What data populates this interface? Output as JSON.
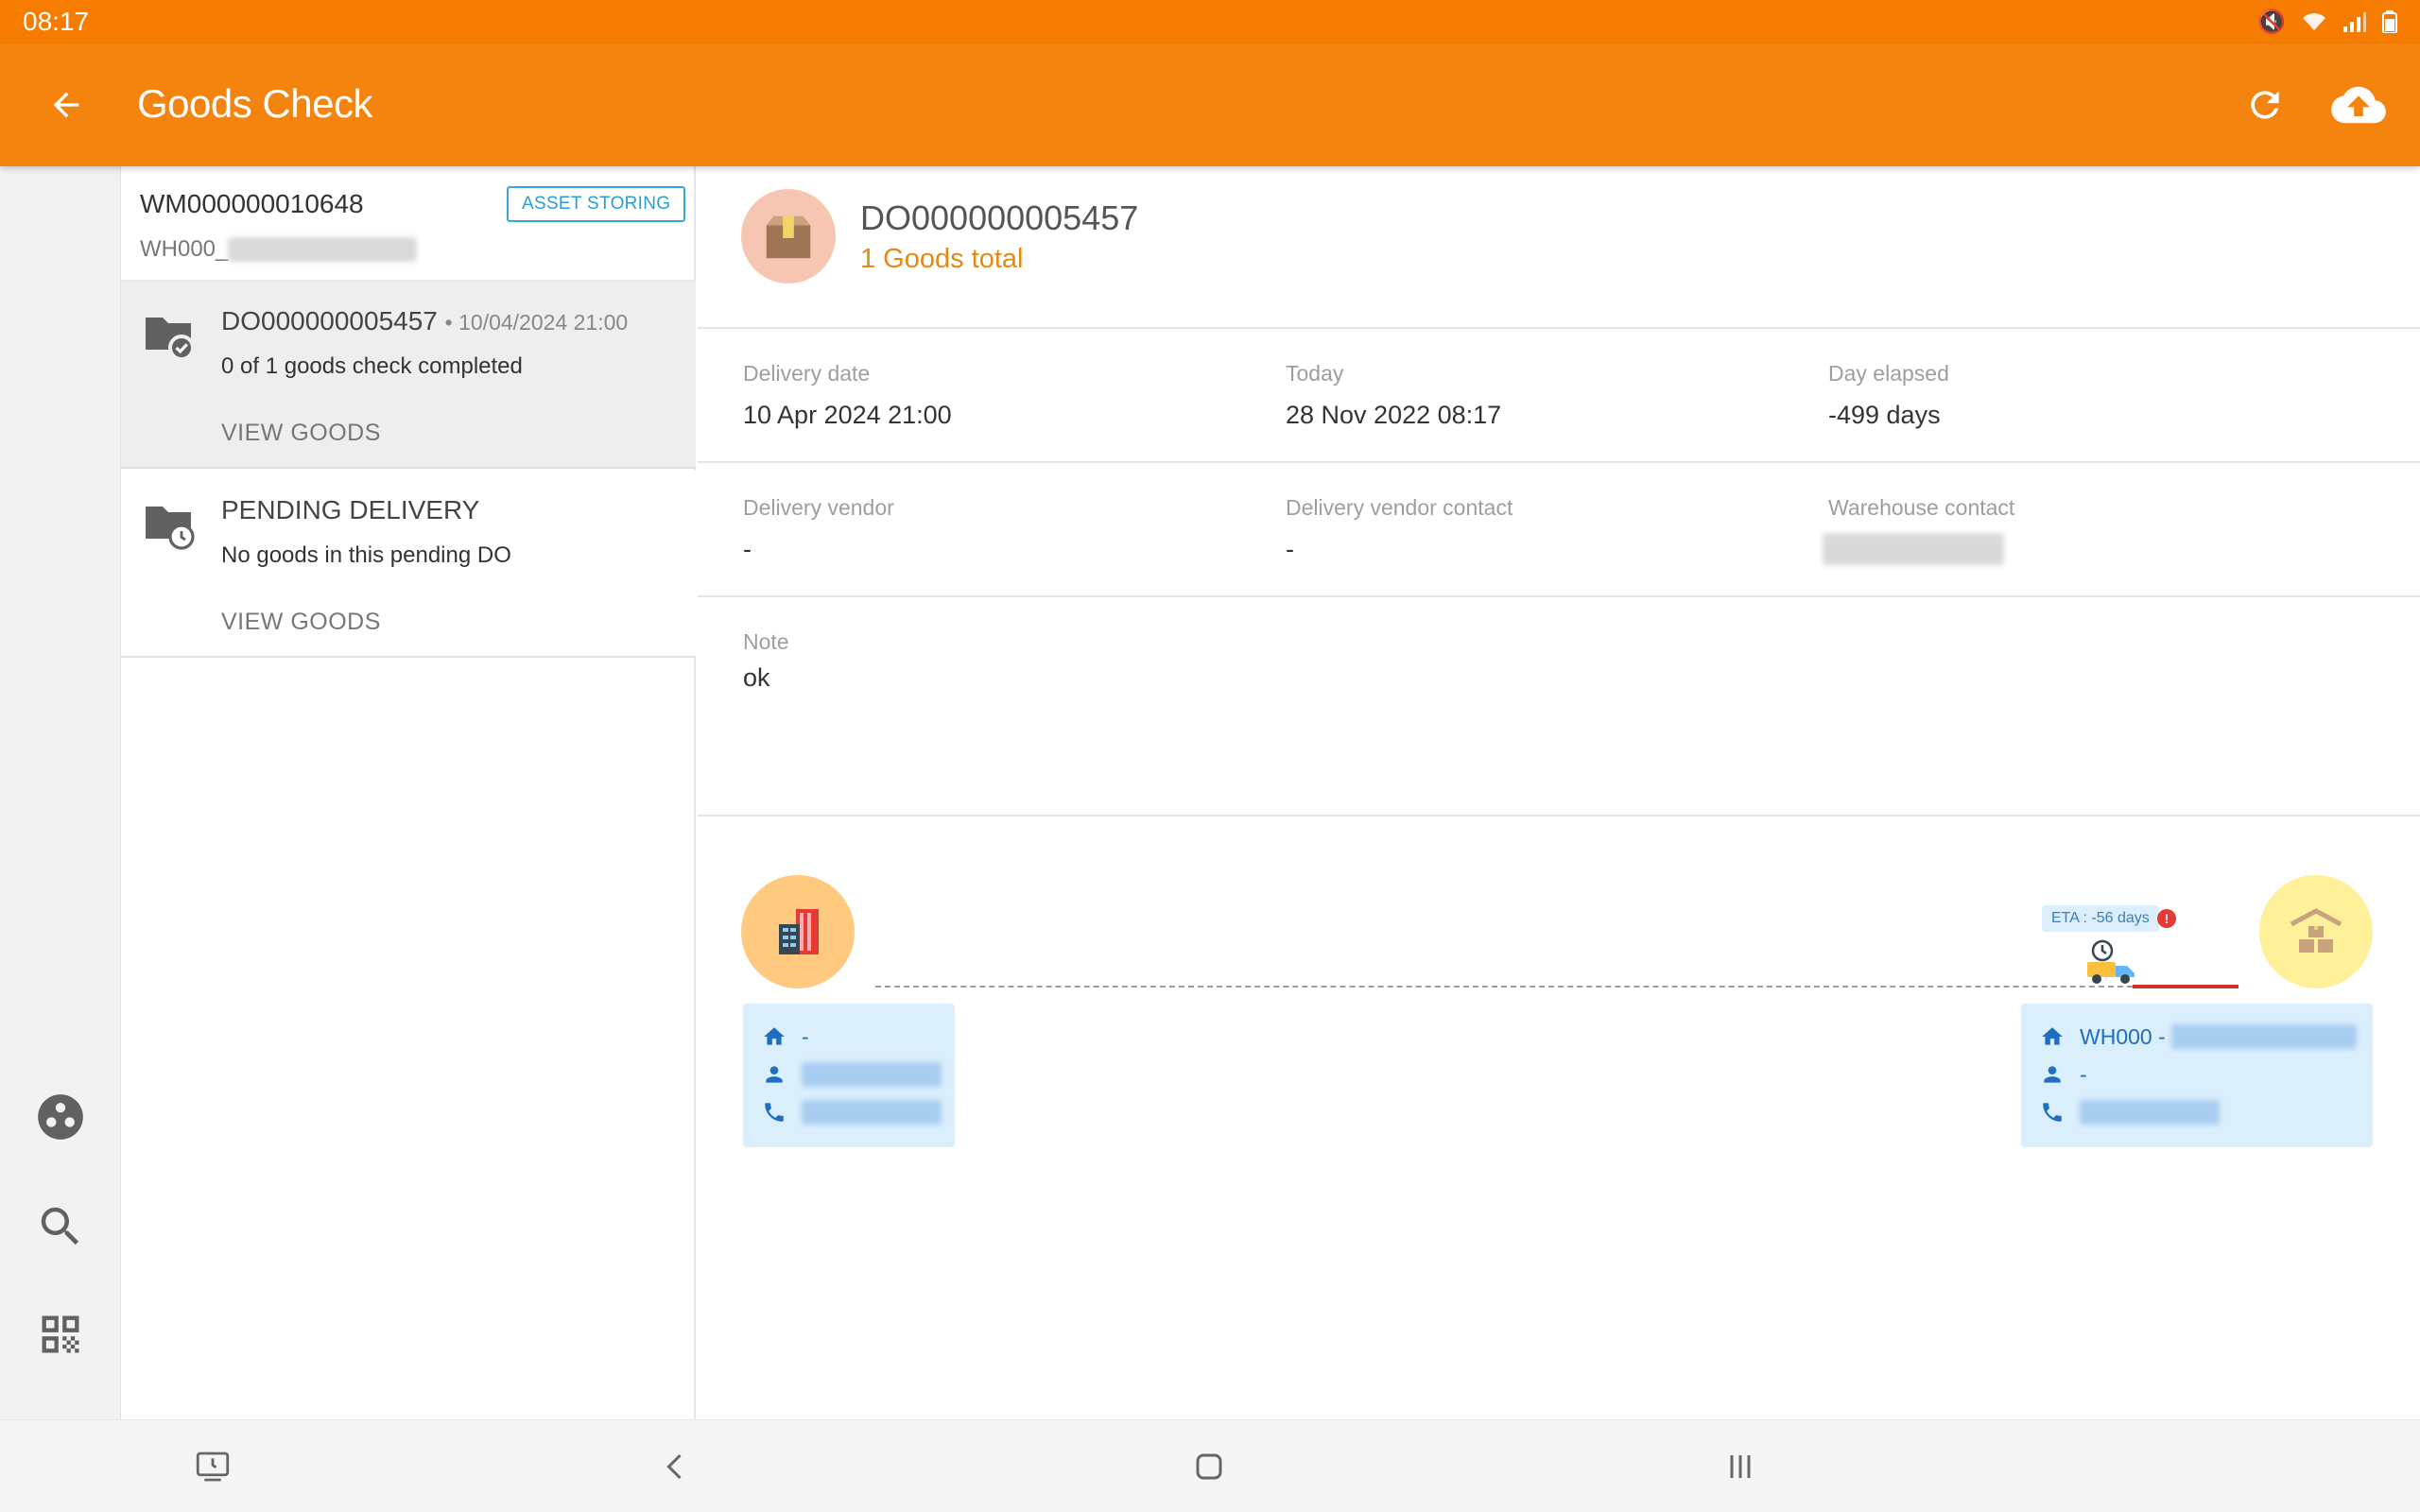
{
  "status_bar": {
    "time": "08:17"
  },
  "app_bar": {
    "title": "Goods Check"
  },
  "list": {
    "wm_code": "WM000000010648",
    "wm_sub_prefix": "WH000_",
    "badge": "ASSET STORING",
    "items": [
      {
        "title": "DO000000005457",
        "date": "10/04/2024 21:00",
        "desc": "0 of  1 goods check completed",
        "action": "VIEW GOODS"
      },
      {
        "title": "PENDING DELIVERY",
        "desc": "No goods in this pending DO",
        "action": "VIEW GOODS"
      }
    ]
  },
  "detail": {
    "do_code": "DO000000005457",
    "goods_total": "1 Goods total",
    "fields": {
      "delivery_date_label": "Delivery date",
      "delivery_date_value": "10 Apr 2024 21:00",
      "today_label": "Today",
      "today_value": "28 Nov 2022 08:17",
      "elapsed_label": "Day elapsed",
      "elapsed_value": "-499 days",
      "vendor_label": "Delivery vendor",
      "vendor_value": "-",
      "vendor_contact_label": "Delivery vendor contact",
      "vendor_contact_value": "-",
      "warehouse_contact_label": "Warehouse contact",
      "note_label": "Note",
      "note_value": "ok"
    },
    "route": {
      "eta": "ETA : -56 days",
      "alert": "!",
      "origin": {
        "address": "-"
      },
      "destination": {
        "address_prefix": "WH000 -",
        "person": "-"
      }
    }
  },
  "colors": {
    "primary": "#f5840f",
    "status_bar": "#f57c00",
    "accent_text": "#e58a10",
    "badge_blue": "#2b9bd8",
    "card_bg": "#dbeefc"
  },
  "icons": {
    "back": "arrow-left-icon",
    "refresh": "refresh-icon",
    "upload": "cloud-upload-icon",
    "rail": [
      "group-icon",
      "search-icon",
      "qr-code-icon"
    ]
  }
}
